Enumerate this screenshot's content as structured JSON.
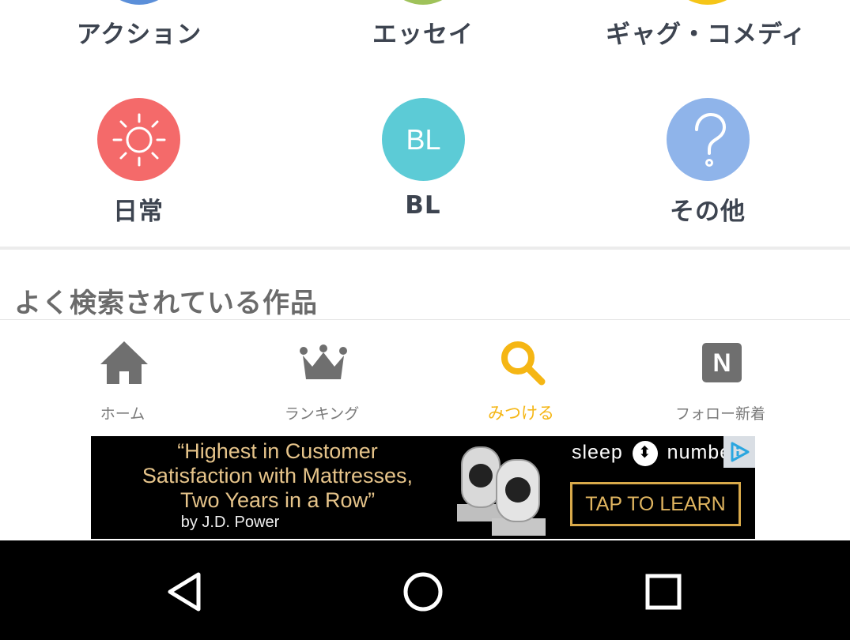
{
  "genres_top": [
    {
      "label": "アクション",
      "color": "#5b8fd9"
    },
    {
      "label": "エッセイ",
      "color": "#9fc25a"
    },
    {
      "label": "ギャグ・コメディ",
      "color": "#f5c518"
    }
  ],
  "genres": [
    {
      "label": "日常",
      "icon": "sun-icon",
      "color": "#f46a6a"
    },
    {
      "label": "BL",
      "icon_text": "BL",
      "color": "#5ccbd6"
    },
    {
      "label": "その他",
      "icon": "question-icon",
      "color": "#8fb4ea"
    }
  ],
  "section": {
    "title": "よく検索されている作品"
  },
  "tabs": [
    {
      "label": "ホーム",
      "icon": "home-icon",
      "active": false
    },
    {
      "label": "ランキング",
      "icon": "crown-icon",
      "active": false
    },
    {
      "label": "みつける",
      "icon": "search-icon",
      "active": true
    },
    {
      "label": "フォロー新着",
      "icon": "n-badge-icon",
      "icon_text": "N",
      "active": false
    }
  ],
  "ad": {
    "quote_line1": "“Highest in Customer",
    "quote_line2": "Satisfaction with Mattresses,",
    "quote_line3": "Two Years in a Row”",
    "attribution": "by J.D. Power",
    "brand_left": "sleep",
    "brand_right": "numbe",
    "cta": "TAP TO LEARN"
  },
  "colors": {
    "accent": "#f5b614",
    "tab_inactive": "#7a7a7a",
    "text_dark": "#3d4450"
  }
}
